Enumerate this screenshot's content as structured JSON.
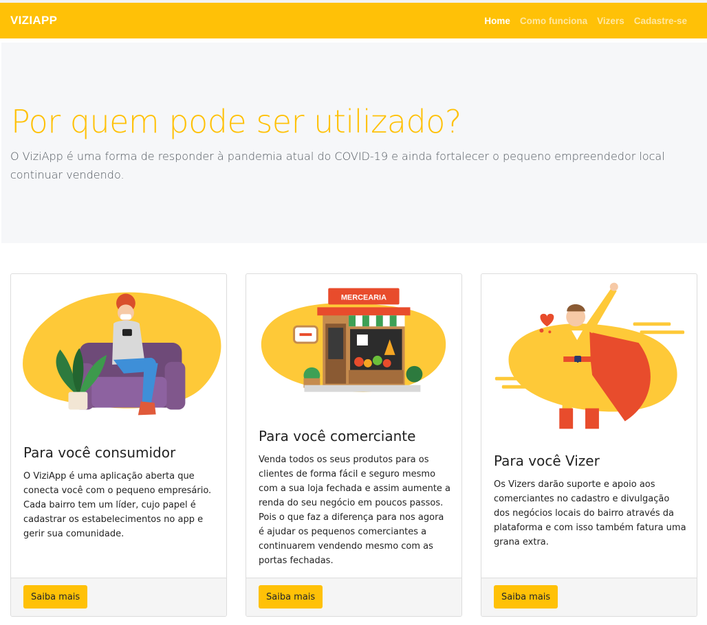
{
  "navbar": {
    "brand": "VIZIAPP",
    "links": [
      {
        "label": "Home",
        "active": true
      },
      {
        "label": "Como funciona",
        "active": false
      },
      {
        "label": "Vizers",
        "active": false
      },
      {
        "label": "Cadastre-se",
        "active": false
      }
    ]
  },
  "hero": {
    "title": "Por quem pode ser utilizado?",
    "lead": "O ViziApp é uma forma de responder à pandemia atual do COVID-19 e ainda fortalecer o pequeno empreendedor local continuar vendendo."
  },
  "cards": [
    {
      "title": "Para você consumidor",
      "text": "O ViziApp é uma aplicação aberta que conecta você com o pequeno empresário. Cada bairro tem um líder, cujo papel é cadastrar os estabelecimentos no app e gerir sua comunidade.",
      "button": "Saiba mais",
      "illustration": "woman-on-sofa-illustration"
    },
    {
      "title": "Para você comerciante",
      "text": "Venda todos os seus produtos para os clientes de forma fácil e seguro mesmo com a sua loja fechada e assim aumente a renda do seu negócio em poucos passos. Pois o que faz a diferença para nos agora é ajudar os pequenos comerciantes a continuarem vendendo mesmo com as portas fechadas.",
      "button": "Saiba mais",
      "illustration": "grocery-store-illustration",
      "sign": "MERCEARIA"
    },
    {
      "title": "Para você Vizer",
      "text": "Os Vizers darão suporte e apoio aos comerciantes no cadastro e divulgação dos negócios locais do bairro através da plataforma e com isso também fatura uma grana extra.",
      "button": "Saiba mais",
      "illustration": "superhero-illustration"
    }
  ],
  "colors": {
    "accent": "#ffc107",
    "hero_bg": "#f6f7f9",
    "card_footer_bg": "#f5f5f5"
  }
}
